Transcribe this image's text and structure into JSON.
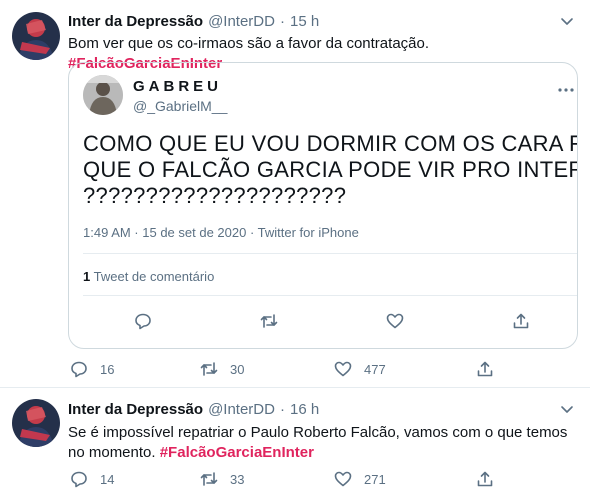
{
  "tweets": [
    {
      "author": "Inter da Depressão",
      "handle": "@InterDD",
      "separator": "·",
      "time": "15 h",
      "text": "Bom ver que os co-irmaos são a favor da contratação. ",
      "hashtag": "#FalcãoGarciaEnInter",
      "quote": {
        "author": "GABREU",
        "handle": "@_GabrielM__",
        "lines": [
          "COMO QUE EU VOU DORMIR COM OS CARA FALANDO",
          "QUE O FALCÃO GARCIA PODE VIR PRO INTER",
          "?????????????????????"
        ],
        "meta": "1:49 AM · 15 de set de 2020 · Twitter for iPhone",
        "retweet_count": "1",
        "retweet_label": "Tweet de comentário"
      },
      "replies": "16",
      "retweets": "30",
      "likes": "477"
    },
    {
      "author": "Inter da Depressão",
      "handle": "@InterDD",
      "separator": "·",
      "time": "16 h",
      "text": "Se é impossível repatriar o Paulo Roberto Falcão, vamos com o que temos no momento. ",
      "hashtag": "#FalcãoGarciaEnInter",
      "replies": "14",
      "retweets": "33",
      "likes": "271"
    }
  ],
  "colors": {
    "hashtag": "#e0245e",
    "muted": "#5b7083",
    "border": "#cfd9de"
  },
  "icons": [
    "chevron-down-icon",
    "reply-icon",
    "retweet-icon",
    "like-icon",
    "share-icon"
  ]
}
